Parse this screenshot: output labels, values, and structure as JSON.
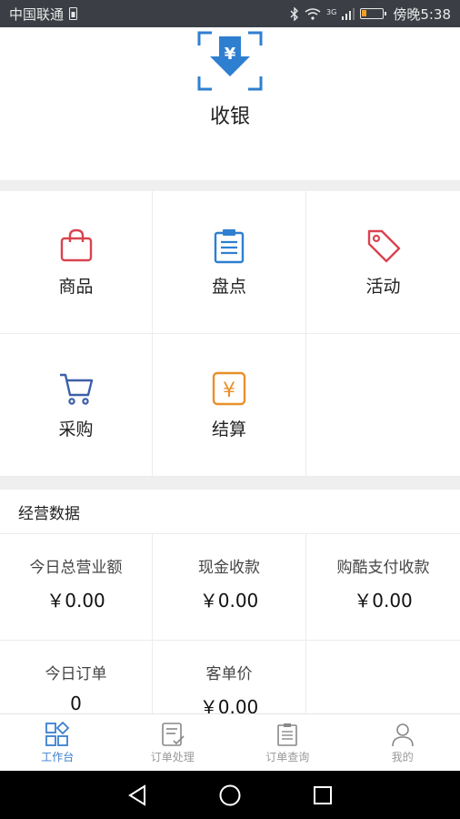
{
  "status": {
    "carrier": "中国联通",
    "network": "3G",
    "time_label": "傍晚5:38"
  },
  "cashier": {
    "label": "收银",
    "icon": "yen-download-scan-icon",
    "color": "#2f7fd0"
  },
  "menu": [
    {
      "label": "商品",
      "icon": "bag-icon",
      "color": "#d9434f"
    },
    {
      "label": "盘点",
      "icon": "clipboard-icon",
      "color": "#2f7fd0"
    },
    {
      "label": "活动",
      "icon": "tag-icon",
      "color": "#d9434f"
    },
    {
      "label": "采购",
      "icon": "cart-icon",
      "color": "#3d5fa8"
    },
    {
      "label": "结算",
      "icon": "yen-box-icon",
      "color": "#e8902a"
    }
  ],
  "business_data": {
    "title": "经营数据",
    "items": [
      {
        "label": "今日总营业额",
        "value": "￥0.00"
      },
      {
        "label": "现金收款",
        "value": "￥0.00"
      },
      {
        "label": "购酷支付收款",
        "value": "￥0.00"
      },
      {
        "label": "今日订单",
        "value": "0"
      },
      {
        "label": "客单价",
        "value": "￥0.00"
      }
    ]
  },
  "tabs": [
    {
      "label": "工作台",
      "icon": "workbench-icon",
      "active": true
    },
    {
      "label": "订单处理",
      "icon": "order-process-icon",
      "active": false
    },
    {
      "label": "订单查询",
      "icon": "order-query-icon",
      "active": false
    },
    {
      "label": "我的",
      "icon": "profile-icon",
      "active": false
    }
  ],
  "colors": {
    "accent": "#3b7fcf",
    "separator": "#efefef"
  }
}
